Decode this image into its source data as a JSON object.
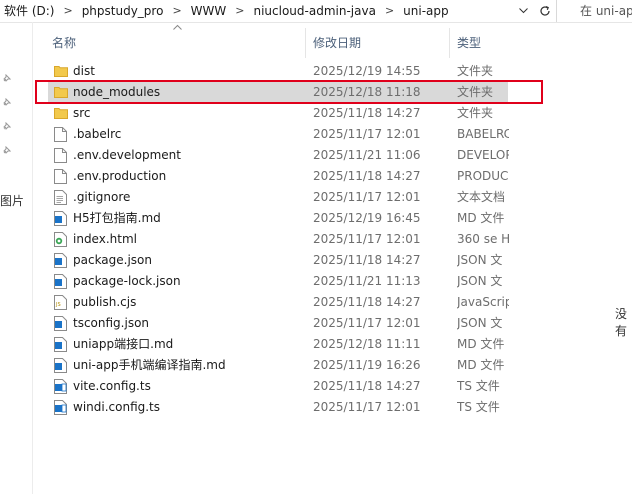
{
  "address_bar": {
    "breadcrumbs": [
      "软件 (D:)",
      "phpstudy_pro",
      "WWW",
      "niucloud-admin-java",
      "uni-app"
    ],
    "separator": ">",
    "dropdown_icon": "chevron-down-icon",
    "refresh_icon": "refresh-icon",
    "search_placeholder": "在 uni-app"
  },
  "nav_pane": {
    "truncated_label": "图片",
    "pins": [
      "pin-icon",
      "pin-icon",
      "pin-icon",
      "pin-icon"
    ]
  },
  "columns": {
    "name": "名称",
    "date": "修改日期",
    "type": "类型"
  },
  "files": [
    {
      "name": "dist",
      "date": "2025/12/19 14:55",
      "type": "文件夹",
      "icon": "folder-icon"
    },
    {
      "name": "node_modules",
      "date": "2025/12/18 11:18",
      "type": "文件夹",
      "icon": "folder-icon",
      "selected": true
    },
    {
      "name": "src",
      "date": "2025/11/18 14:27",
      "type": "文件夹",
      "icon": "folder-icon"
    },
    {
      "name": ".babelrc",
      "date": "2025/11/17 12:01",
      "type": "BABELRC",
      "icon": "file-icon"
    },
    {
      "name": ".env.development",
      "date": "2025/11/21 11:06",
      "type": "DEVELOP",
      "icon": "file-icon"
    },
    {
      "name": ".env.production",
      "date": "2025/11/18 14:27",
      "type": "PRODUC",
      "icon": "file-icon"
    },
    {
      "name": ".gitignore",
      "date": "2025/11/17 12:01",
      "type": "文本文档",
      "icon": "text-file-icon"
    },
    {
      "name": "H5打包指南.md",
      "date": "2025/12/19 16:45",
      "type": "MD 文件",
      "icon": "md-file-icon"
    },
    {
      "name": "index.html",
      "date": "2025/11/17 12:01",
      "type": "360 se H",
      "icon": "html-file-icon"
    },
    {
      "name": "package.json",
      "date": "2025/11/18 14:27",
      "type": "JSON 文",
      "icon": "json-file-icon"
    },
    {
      "name": "package-lock.json",
      "date": "2025/11/21 11:13",
      "type": "JSON 文",
      "icon": "json-file-icon"
    },
    {
      "name": "publish.cjs",
      "date": "2025/11/18 14:27",
      "type": "JavaScrip",
      "icon": "js-file-icon"
    },
    {
      "name": "tsconfig.json",
      "date": "2025/11/17 12:01",
      "type": "JSON 文",
      "icon": "json-file-icon"
    },
    {
      "name": "uniapp端接口.md",
      "date": "2025/12/18 11:11",
      "type": "MD 文件",
      "icon": "md-file-icon"
    },
    {
      "name": "uni-app手机端编译指南.md",
      "date": "2025/11/19 16:26",
      "type": "MD 文件",
      "icon": "md-file-icon"
    },
    {
      "name": "vite.config.ts",
      "date": "2025/11/18 14:27",
      "type": "TS 文件",
      "icon": "ts-file-icon"
    },
    {
      "name": "windi.config.ts",
      "date": "2025/11/17 12:01",
      "type": "TS 文件",
      "icon": "ts-file-icon"
    }
  ],
  "right_edge_text": "没有",
  "colors": {
    "selection": "#d9d9d9",
    "highlight_border": "#e0001b",
    "folder": "#f2c94c",
    "header_text": "#4c607a",
    "blue_icon": "#1a73c8"
  }
}
